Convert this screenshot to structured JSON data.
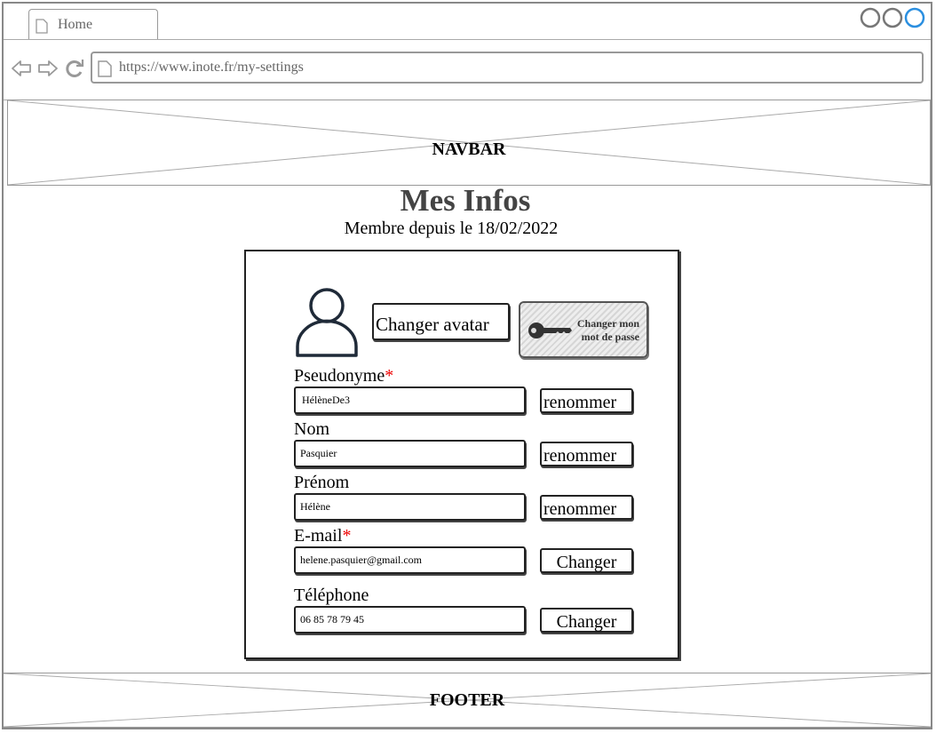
{
  "browser": {
    "tab_label": "Home",
    "url": "https://www.inote.fr/my-settings"
  },
  "navbar": {
    "label": "NAVBAR"
  },
  "footer": {
    "label": "FOOTER"
  },
  "page": {
    "title": "Mes Infos",
    "subtitle": "Membre depuis le 18/02/2022"
  },
  "profile": {
    "change_avatar_label": "Changer avatar",
    "change_password_label": "Changer mon mot de passe"
  },
  "fields": {
    "pseudonyme": {
      "label": "Pseudonyme",
      "required_mark": "*",
      "value": "HélèneDe3",
      "button": "renommer"
    },
    "nom": {
      "label": "Nom",
      "value": "Pasquier",
      "button": "renommer"
    },
    "prenom": {
      "label": "Prénom",
      "value": "Hélène",
      "button": "renommer"
    },
    "email": {
      "label": "E-mail",
      "required_mark": "*",
      "value": "helene.pasquier@gmail.com",
      "button": "Changer"
    },
    "telephone": {
      "label": "Téléphone",
      "value": "06 85 78 79 45",
      "button": "Changer"
    }
  },
  "colors": {
    "required": "#ee0000",
    "window_active_button": "#2b8fe0"
  }
}
